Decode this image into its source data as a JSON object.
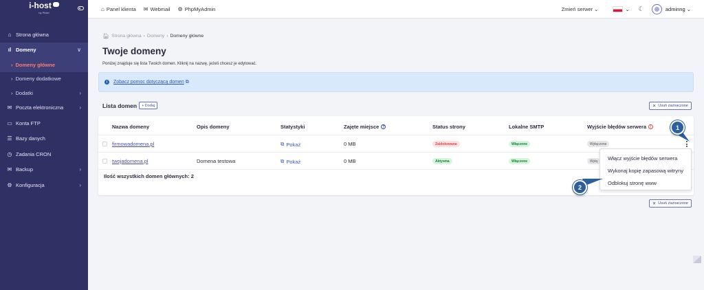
{
  "brand": {
    "name": "i-host",
    "sub": "by Pictel"
  },
  "sidebar": {
    "items": [
      {
        "icon": "home-icon",
        "glyph": "⌂",
        "label": "Strona główna"
      },
      {
        "icon": "chart-icon",
        "glyph": "ıl",
        "label": "Domeny",
        "chevron": "∨"
      },
      {
        "label": "Domeny główne",
        "prefix": "›"
      },
      {
        "label": "Domeny dodatkowe",
        "prefix": "›"
      },
      {
        "label": "Dodatki",
        "prefix": "›",
        "chevron": "›"
      },
      {
        "icon": "mail-icon",
        "glyph": "✉",
        "label": "Poczta elektroniczna",
        "chevron": "›"
      },
      {
        "icon": "folder-icon",
        "glyph": "▭",
        "label": "Konta FTP"
      },
      {
        "icon": "database-icon",
        "glyph": "☰",
        "label": "Bazy danych"
      },
      {
        "icon": "clock-icon",
        "glyph": "◷",
        "label": "Zadania CRON"
      },
      {
        "icon": "backup-icon",
        "glyph": "✉",
        "label": "Backup",
        "chevron": "›"
      },
      {
        "icon": "gear-icon",
        "glyph": "⚙",
        "label": "Konfiguracja",
        "chevron": "›"
      }
    ]
  },
  "topbar": {
    "links": [
      {
        "icon": "home-icon",
        "glyph": "⌂",
        "label": "Panel klienta"
      },
      {
        "icon": "mail-icon",
        "glyph": "✉",
        "label": "Webmail"
      },
      {
        "icon": "gear-icon",
        "glyph": "⚙",
        "label": "PhpMyAdmin"
      }
    ],
    "server_label": "Zmień serwer ⌄",
    "lang_chevron": "⌄",
    "theme_glyph": "☾",
    "user": "adminng ⌄"
  },
  "main": {
    "breadcrumb": [
      "Strona główna",
      "Domeny",
      "Domeny główne"
    ],
    "title": "Twoje domeny",
    "description": "Poniżej znajduje się lista Twoich domen. Kliknij na nazwę, jeżeli chcesz je edytować.",
    "info_link": "Zobacz pomoc dotyczącą domen",
    "list_title": "Lista domen",
    "add_label": "+ Dodaj",
    "remove_label": "Usuń zaznaczone"
  },
  "table": {
    "headers": {
      "name": "Nazwa domeny",
      "desc": "Opis domeny",
      "stats": "Statystyki",
      "space": "Zajęte miejsce",
      "status": "Status strony",
      "smtp": "Lokalne SMTP",
      "errors": "Wyjście błędów serwera"
    },
    "rows": [
      {
        "name": "firmowadomena.pl",
        "desc": "",
        "stats": "Pokaż",
        "space": "0 MB",
        "status": "Zablokowana",
        "smtp": "Włączone",
        "errors": "Wyłączone"
      },
      {
        "name": "twojadomena.pl",
        "desc": "Domena testowa",
        "stats": "Pokaż",
        "space": "0 MB",
        "status": "Aktywna",
        "smtp": "Włączone",
        "errors": "Wyłą"
      }
    ],
    "total": "Ilość wszystkich domen głównych: 2"
  },
  "dropdown": {
    "items": [
      "Włącz wyjście błędów serwera",
      "Wykonaj kopię zapasową witryny",
      "Odblokuj stronę www"
    ]
  },
  "steps": [
    "1",
    "2"
  ],
  "colors": {
    "sidebar": "#2f3064",
    "accent": "#4b4fa8",
    "active_nav": "#ff7a70",
    "step": "#2d5f9d"
  }
}
